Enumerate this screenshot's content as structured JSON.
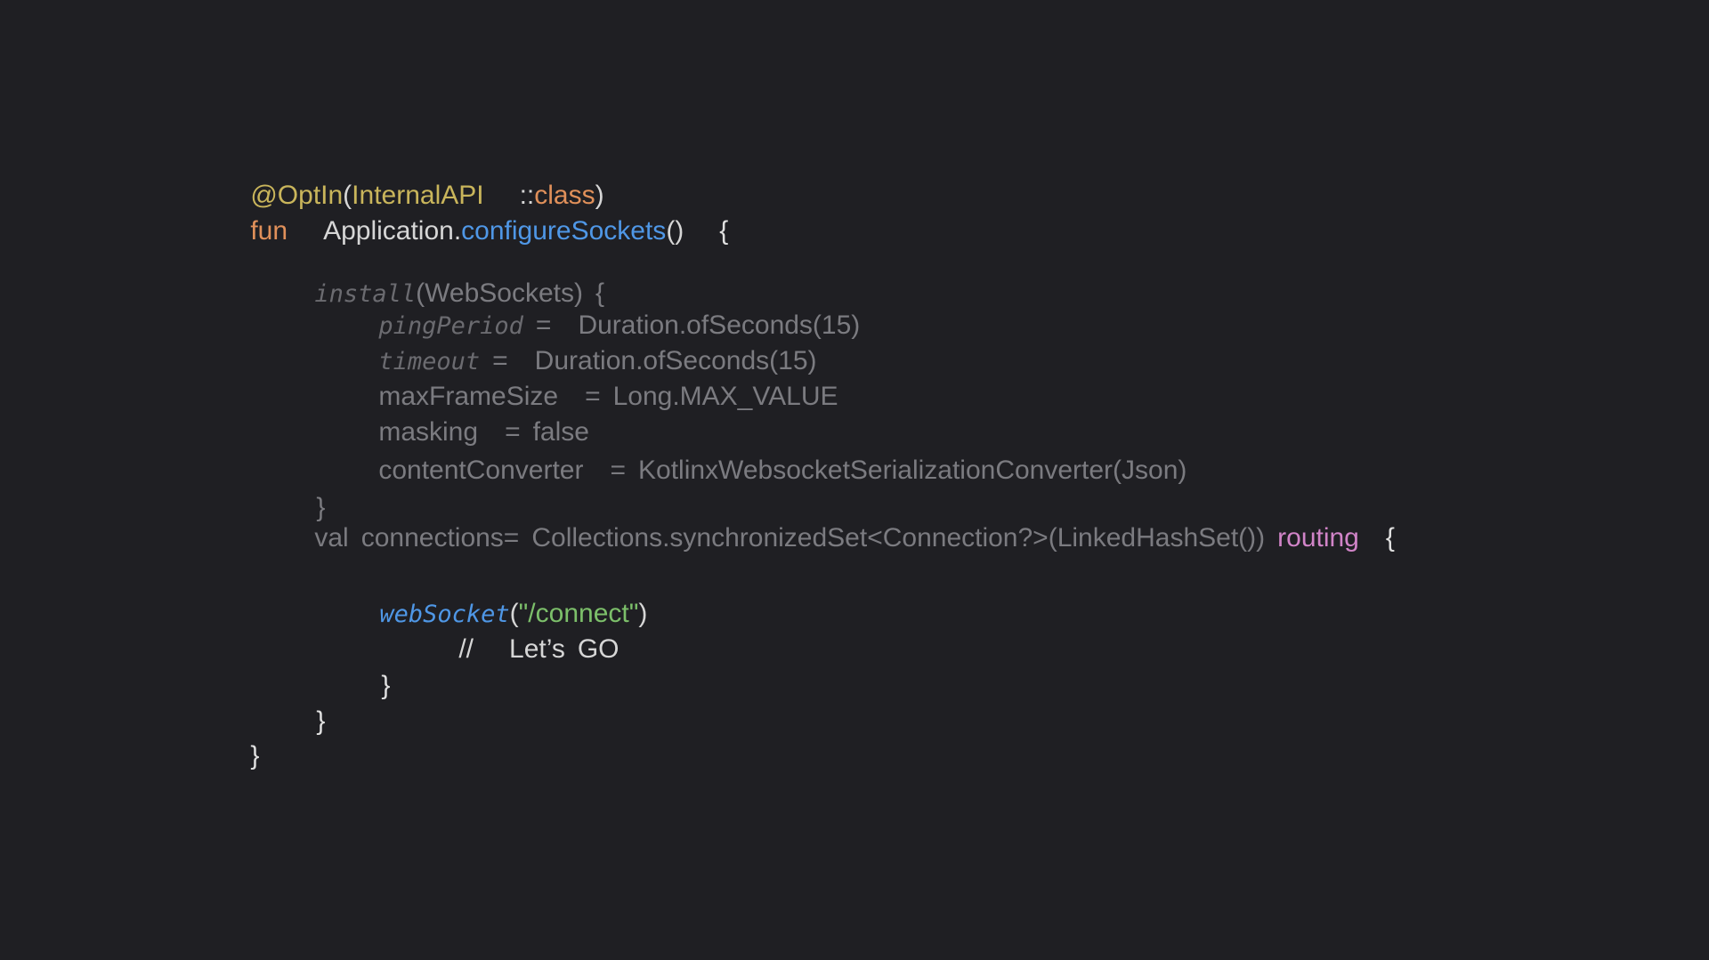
{
  "colors": {
    "background": "#1f1f23",
    "annotation": "#c9b55b",
    "keyword": "#e0905a",
    "function": "#4f97e6",
    "plain": "#d6d6d6",
    "dim": "#7b7b80",
    "dim_italic": "#6b6b70",
    "string": "#7cbf6a",
    "routing": "#d184c8",
    "brace": "#e0e0e0"
  },
  "code": {
    "l1": {
      "annotation": "@OptIn",
      "open": "(",
      "arg": "InternalAPI",
      "sep": "::",
      "kw": "class",
      "close": ")"
    },
    "l2": {
      "kw": "fun",
      "receiver": "Application.",
      "name": "configureSockets",
      "parens": "()",
      "brace": "{"
    },
    "l3": {
      "fn": "install",
      "arg": "(WebSockets)",
      "brace": "{"
    },
    "l4": {
      "prop": "pingPeriod",
      "eq": "=",
      "value": "Duration.ofSeconds(15)"
    },
    "l5": {
      "prop": "timeout",
      "eq": "=",
      "value": "Duration.ofSeconds(15)"
    },
    "l6": {
      "prop": "maxFrameSize",
      "eq": "=",
      "value": "Long.MAX_VALUE"
    },
    "l7": {
      "prop": "masking",
      "eq": "=",
      "value": "false"
    },
    "l8": {
      "prop": "contentConverter",
      "eq": "=",
      "value": "KotlinxWebsocketSerializationConverter(Json)"
    },
    "l9": {
      "brace": "}"
    },
    "l10": {
      "kw": "val",
      "name": "connections=",
      "value": "Collections.synchronizedSet<Connection?>(LinkedHashSet())",
      "routing": "routing",
      "brace": "{"
    },
    "l11": {
      "fn": "webSocket",
      "open": "(",
      "str": "\"/connect\"",
      "close": ")"
    },
    "l12": {
      "slashes": "//",
      "text1": "Let’s",
      "text2": "GO"
    },
    "l13": {
      "brace": "}"
    },
    "l14": {
      "brace": "}"
    },
    "l15": {
      "brace": "}"
    }
  }
}
